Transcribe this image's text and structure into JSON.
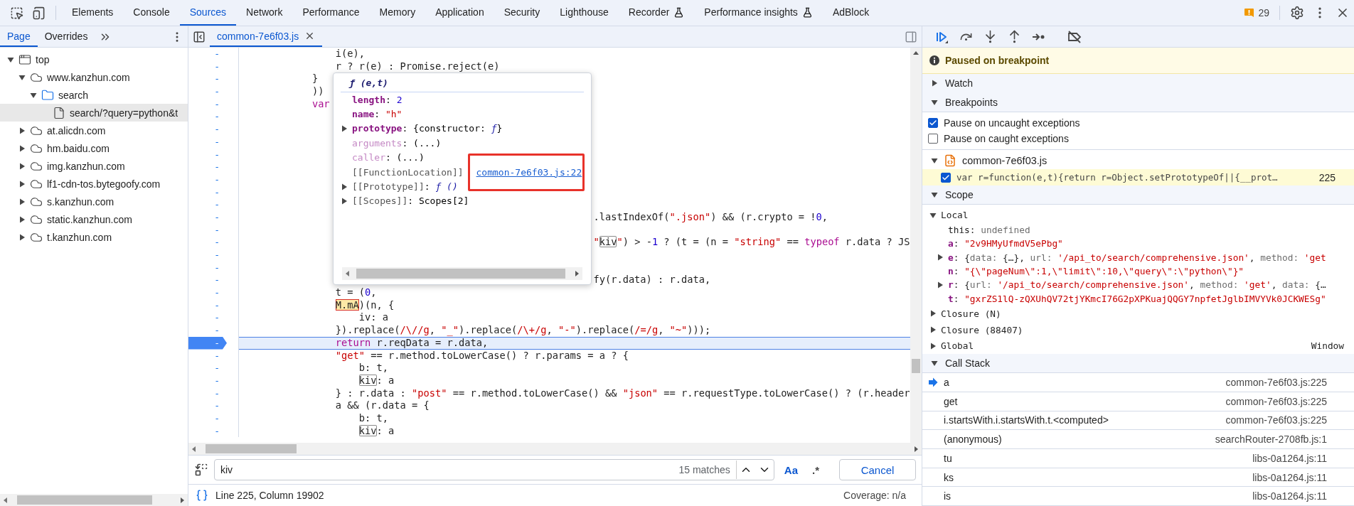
{
  "toolbar": {
    "tabs": [
      {
        "label": "Elements",
        "selected": false,
        "experimental": false
      },
      {
        "label": "Console",
        "selected": false,
        "experimental": false
      },
      {
        "label": "Sources",
        "selected": true,
        "experimental": false
      },
      {
        "label": "Network",
        "selected": false,
        "experimental": false
      },
      {
        "label": "Performance",
        "selected": false,
        "experimental": false
      },
      {
        "label": "Memory",
        "selected": false,
        "experimental": false
      },
      {
        "label": "Application",
        "selected": false,
        "experimental": false
      },
      {
        "label": "Security",
        "selected": false,
        "experimental": false
      },
      {
        "label": "Lighthouse",
        "selected": false,
        "experimental": false
      },
      {
        "label": "Recorder",
        "selected": false,
        "experimental": true
      },
      {
        "label": "Performance insights",
        "selected": false,
        "experimental": true
      },
      {
        "label": "AdBlock",
        "selected": false,
        "experimental": false
      }
    ],
    "issues_count": "29"
  },
  "navigator": {
    "tabs": [
      {
        "label": "Page",
        "selected": true
      },
      {
        "label": "Overrides",
        "selected": false
      }
    ],
    "tree": [
      {
        "label": "top",
        "kind": "frame",
        "expanded": true,
        "selected": false,
        "children": [
          {
            "label": "www.kanzhun.com",
            "kind": "domain",
            "expanded": true,
            "selected": false,
            "children": [
              {
                "label": "search",
                "kind": "folder",
                "expanded": true,
                "selected": false,
                "children": [
                  {
                    "label": "search/?query=python&t",
                    "kind": "file",
                    "selected": true
                  }
                ]
              }
            ]
          },
          {
            "label": "at.alicdn.com",
            "kind": "domain",
            "expanded": false,
            "selected": false
          },
          {
            "label": "hm.baidu.com",
            "kind": "domain",
            "expanded": false,
            "selected": false
          },
          {
            "label": "img.kanzhun.com",
            "kind": "domain",
            "expanded": false,
            "selected": false
          },
          {
            "label": "lf1-cdn-tos.bytegoofy.com",
            "kind": "domain",
            "expanded": false,
            "selected": false
          },
          {
            "label": "s.kanzhun.com",
            "kind": "domain",
            "expanded": false,
            "selected": false
          },
          {
            "label": "static.kanzhun.com",
            "kind": "domain",
            "expanded": false,
            "selected": false
          },
          {
            "label": "t.kanzhun.com",
            "kind": "domain",
            "expanded": false,
            "selected": false
          }
        ]
      }
    ]
  },
  "editor": {
    "tabs": [
      {
        "label": "common-7e6f03.js",
        "selected": true
      }
    ],
    "lines": [
      {
        "gutter": "-",
        "paused": false,
        "segments": [
          "                i(e),"
        ]
      },
      {
        "gutter": "-",
        "paused": false,
        "segments": [
          "                r ? r(e) : Promise.reject(e)"
        ]
      },
      {
        "gutter": "-",
        "paused": false,
        "segments": [
          "            }"
        ]
      },
      {
        "gutter": "-",
        "paused": false,
        "segments": [
          "            ))"
        ]
      },
      {
        "gutter": "-",
        "paused": false,
        "segments": [
          {
            "text": "            var",
            "kind": "keyword"
          }
        ]
      },
      {
        "gutter": "-",
        "paused": false
      },
      {
        "gutter": "-",
        "paused": false
      },
      {
        "gutter": "-",
        "paused": false
      },
      {
        "gutter": "-",
        "paused": false
      },
      {
        "gutter": "-",
        "paused": false
      },
      {
        "gutter": "-",
        "paused": false
      },
      {
        "gutter": "-",
        "paused": false
      },
      {
        "gutter": "-",
        "paused": false
      },
      {
        "gutter": "-",
        "paused": false,
        "segments": [
          "                                                            .lastIndexOf(",
          {
            "text": "\".json\"",
            "kind": "string"
          },
          ") && (r.crypto = !",
          {
            "text": "0",
            "kind": "number"
          },
          ","
        ]
      },
      {
        "gutter": "-",
        "paused": false
      },
      {
        "gutter": "-",
        "paused": false,
        "segments": [
          {
            "text": "                                                            \"",
            "kind": "string"
          },
          {
            "text": "kiv",
            "kind": "match"
          },
          {
            "text": "\"",
            "kind": "string"
          },
          ") > -",
          {
            "text": "1",
            "kind": "number"
          },
          " ? (t = (n = ",
          {
            "text": "\"string\"",
            "kind": "string"
          },
          " == ",
          {
            "text": "typeof",
            "kind": "keyword"
          },
          " r.data ? JS"
        ]
      },
      {
        "gutter": "-",
        "paused": false
      },
      {
        "gutter": "-",
        "paused": false
      },
      {
        "gutter": "-",
        "paused": false,
        "segments": [
          "                                                            fy(r.data) : r.data,"
        ]
      },
      {
        "gutter": "-",
        "paused": false,
        "segments": [
          "                t = (",
          {
            "text": "0",
            "kind": "number"
          },
          ","
        ]
      },
      {
        "gutter": "-",
        "paused": false,
        "segments": [
          {
            "text": "                M.mA",
            "kind": "current"
          },
          ")(n, {"
        ]
      },
      {
        "gutter": "-",
        "paused": false,
        "segments": [
          "                    iv: a"
        ]
      },
      {
        "gutter": "-",
        "paused": false,
        "segments": [
          "                }).replace(",
          {
            "text": "/\\//g",
            "kind": "string"
          },
          ", ",
          {
            "text": "\"_\"",
            "kind": "string"
          },
          ").replace(",
          {
            "text": "/\\+/g",
            "kind": "string"
          },
          ", ",
          {
            "text": "\"-\"",
            "kind": "string"
          },
          ").replace(",
          {
            "text": "/=/g",
            "kind": "string"
          },
          ", ",
          {
            "text": "\"~\"",
            "kind": "string"
          },
          ")));"
        ]
      },
      {
        "gutter": "-",
        "paused": true,
        "segments": [
          {
            "text": "                return",
            "kind": "keyword"
          },
          " r.reqData = r.data,"
        ]
      },
      {
        "gutter": "-",
        "paused": false,
        "segments": [
          {
            "text": "                \"get\"",
            "kind": "string"
          },
          " == r.method.toLowerCase() ? r.params = a ? {"
        ]
      },
      {
        "gutter": "-",
        "paused": false,
        "segments": [
          "                    b: t,"
        ]
      },
      {
        "gutter": "-",
        "paused": false,
        "segments": [
          {
            "text": "                    kiv",
            "kind": "match"
          },
          ": a"
        ]
      },
      {
        "gutter": "-",
        "paused": false,
        "segments": [
          "                } : r.data : ",
          {
            "text": "\"post\"",
            "kind": "string"
          },
          " == r.method.toLowerCase() && ",
          {
            "text": "\"json\"",
            "kind": "string"
          },
          " == r.requestType.toLowerCase() ? (r.header"
        ]
      },
      {
        "gutter": "-",
        "paused": false,
        "segments": [
          "                a && (r.data = {"
        ]
      },
      {
        "gutter": "-",
        "paused": false,
        "segments": [
          "                    b: t,"
        ]
      },
      {
        "gutter": "-",
        "paused": false,
        "segments": [
          {
            "text": "                    kiv",
            "kind": "match"
          },
          ": a"
        ]
      }
    ],
    "popover": {
      "signature": "ƒ (e,t)",
      "properties": [
        {
          "name": "length",
          "kind": "own",
          "expandable": false,
          "highlighted": false,
          "value": [
            ": ",
            {
              "text": "2",
              "kind": "number"
            }
          ]
        },
        {
          "name": "name",
          "kind": "own",
          "expandable": false,
          "highlighted": false,
          "value": [
            ": ",
            {
              "text": "\"h\"",
              "kind": "string"
            }
          ]
        },
        {
          "name": "prototype",
          "kind": "own",
          "expandable": true,
          "highlighted": false,
          "value": [
            ": {constructor: ",
            {
              "text": "ƒ",
              "kind": "fn"
            },
            "}"
          ]
        },
        {
          "name": "arguments",
          "kind": "nonenumerable",
          "expandable": false,
          "highlighted": false,
          "value": [
            ": (...)"
          ]
        },
        {
          "name": "caller",
          "kind": "nonenumerable",
          "expandable": false,
          "highlighted": false,
          "value": [
            ": (...)"
          ]
        },
        {
          "name": "[[FunctionLocation]]",
          "kind": "internal",
          "expandable": false,
          "highlighted": true,
          "value": [
            {
              "text": "common-7e6f03.js:22",
              "kind": "link"
            }
          ]
        },
        {
          "name": "[[Prototype]]",
          "kind": "internal",
          "expandable": true,
          "highlighted": false,
          "value": [
            ": ",
            {
              "text": "ƒ ()",
              "kind": "fn"
            }
          ]
        },
        {
          "name": "[[Scopes]]",
          "kind": "internal",
          "expandable": true,
          "highlighted": false,
          "value": [
            ": Scopes[2]"
          ]
        }
      ]
    },
    "search": {
      "query": "kiv",
      "matches": "15 matches",
      "options": [
        {
          "label": "Aa",
          "on": true
        },
        {
          "label": ".*",
          "on": false
        }
      ],
      "cancel": "Cancel"
    },
    "status": {
      "position": "Line 225, Column 19902",
      "coverage": "Coverage: n/a"
    }
  },
  "debugger": {
    "banner": "Paused on breakpoint",
    "watch": {
      "title": "Watch",
      "expanded": false
    },
    "breakpoints": {
      "title": "Breakpoints",
      "expanded": true,
      "options": [
        {
          "label": "Pause on uncaught exceptions",
          "checked": true
        },
        {
          "label": "Pause on caught exceptions",
          "checked": false
        }
      ],
      "files": [
        {
          "name": "common-7e6f03.js",
          "expanded": true,
          "items": [
            {
              "code": "var r=function(e,t){return r=Object.setPrototypeOf||{__prot…",
              "line": "225",
              "checked": true,
              "hit": true
            }
          ]
        }
      ]
    },
    "scope": {
      "title": "Scope",
      "expanded": true,
      "scopes": [
        {
          "name": "Local",
          "expanded": true,
          "variables": [
            {
              "name": "this",
              "kind": "receiver",
              "expandable": false,
              "value": [
                ": ",
                {
                  "text": "undefined",
                  "kind": "dim"
                }
              ]
            },
            {
              "name": "a",
              "kind": "variable",
              "expandable": false,
              "value": [
                ": ",
                {
                  "text": "\"2v9HMyUfmdV5ePbg\"",
                  "kind": "string"
                }
              ]
            },
            {
              "name": "e",
              "kind": "variable",
              "expandable": true,
              "value": [
                ": {",
                {
                  "text": "data: ",
                  "kind": "dim"
                },
                "{…}, ",
                {
                  "text": "url: ",
                  "kind": "dim"
                },
                {
                  "text": "'/api_to/search/comprehensive.json'",
                  "kind": "string"
                },
                ", ",
                {
                  "text": "method: ",
                  "kind": "dim"
                },
                {
                  "text": "'get",
                  "kind": "string"
                }
              ]
            },
            {
              "name": "n",
              "kind": "variable",
              "expandable": false,
              "value": [
                ": ",
                {
                  "text": "\"{\\\"pageNum\\\":1,\\\"limit\\\":10,\\\"query\\\":\\\"python\\\"}\"",
                  "kind": "string"
                }
              ]
            },
            {
              "name": "r",
              "kind": "variable",
              "expandable": true,
              "value": [
                ": {",
                {
                  "text": "url: ",
                  "kind": "dim"
                },
                {
                  "text": "'/api_to/search/comprehensive.json'",
                  "kind": "string"
                },
                ", ",
                {
                  "text": "method: ",
                  "kind": "dim"
                },
                {
                  "text": "'get'",
                  "kind": "string"
                },
                ", ",
                {
                  "text": "data: ",
                  "kind": "dim"
                },
                "{…"
              ]
            },
            {
              "name": "t",
              "kind": "variable",
              "expandable": false,
              "value": [
                ": ",
                {
                  "text": "\"gxrZS1lQ-zQXUhQV72tjYKmcI76G2pXPKuajQQGY7npfetJglbIMVYVk0JCKWESg\"",
                  "kind": "string"
                }
              ]
            }
          ]
        },
        {
          "name": "Closure (N)",
          "expanded": false
        },
        {
          "name": "Closure (88407)",
          "expanded": false
        },
        {
          "name": "Global",
          "expanded": false,
          "value": "Window"
        }
      ]
    },
    "call_stack": {
      "title": "Call Stack",
      "expanded": true,
      "frames": [
        {
          "name": "a",
          "location": "common-7e6f03.js:225",
          "current": true
        },
        {
          "name": "get",
          "location": "common-7e6f03.js:225",
          "current": false
        },
        {
          "name": "i.startsWith.i.startsWith.t.<computed>",
          "location": "common-7e6f03.js:225",
          "current": false
        },
        {
          "name": "(anonymous)",
          "location": "searchRouter-2708fb.js:1",
          "current": false
        },
        {
          "name": "tu",
          "location": "libs-0a1264.js:11",
          "current": false
        },
        {
          "name": "ks",
          "location": "libs-0a1264.js:11",
          "current": false
        },
        {
          "name": "is",
          "location": "libs-0a1264.js:11",
          "current": false
        }
      ]
    }
  }
}
